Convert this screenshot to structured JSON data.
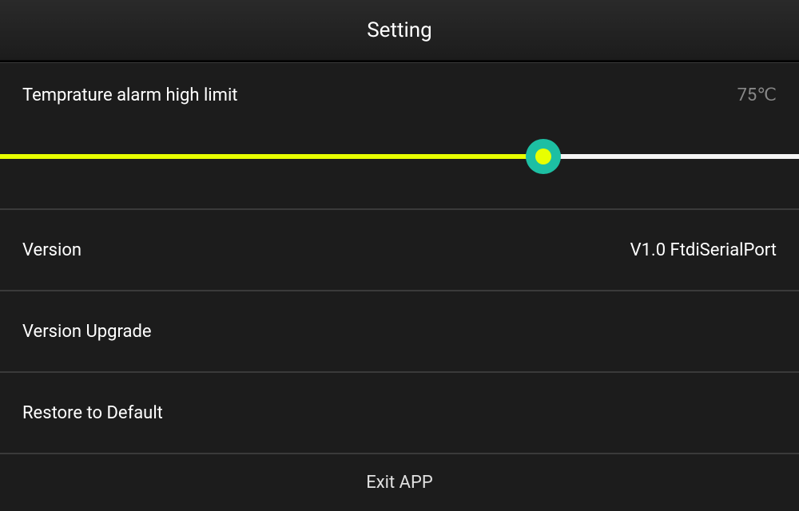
{
  "header": {
    "title": "Setting"
  },
  "temperature": {
    "label": "Temprature alarm high limit",
    "value": "75℃",
    "slider_percent": 68
  },
  "version": {
    "label": "Version",
    "value": "V1.0  FtdiSerialPort"
  },
  "upgrade": {
    "label": "Version Upgrade"
  },
  "restore": {
    "label": "Restore to Default"
  },
  "exit": {
    "label": "Exit APP"
  }
}
